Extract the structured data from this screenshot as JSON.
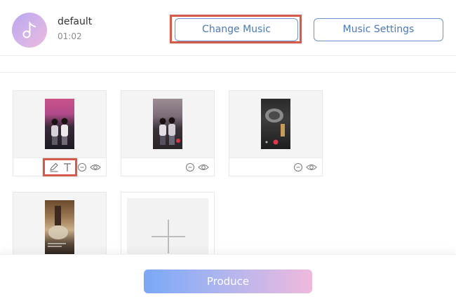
{
  "music": {
    "icon": "music-note-icon",
    "track_name": "default",
    "duration": "01:02",
    "change_label": "Change Music",
    "settings_label": "Music Settings"
  },
  "clips": [
    {
      "thumbnail": "video-thumbnail",
      "actions": [
        "edit-icon",
        "text-icon",
        "remove-icon",
        "preview-icon"
      ]
    },
    {
      "thumbnail": "video-thumbnail",
      "actions": [
        "remove-icon",
        "preview-icon"
      ]
    },
    {
      "thumbnail": "video-thumbnail",
      "actions": [
        "remove-icon",
        "preview-icon"
      ]
    },
    {
      "thumbnail": "video-thumbnail",
      "actions": []
    }
  ],
  "add_clip": {
    "icon": "plus-icon"
  },
  "footer": {
    "produce_label": "Produce"
  },
  "colors": {
    "accent_blue": "#4d79b0",
    "highlight_red": "#d65a4a",
    "produce_gradient_start": "#7aa8f7",
    "produce_gradient_end": "#f0b9dd"
  }
}
